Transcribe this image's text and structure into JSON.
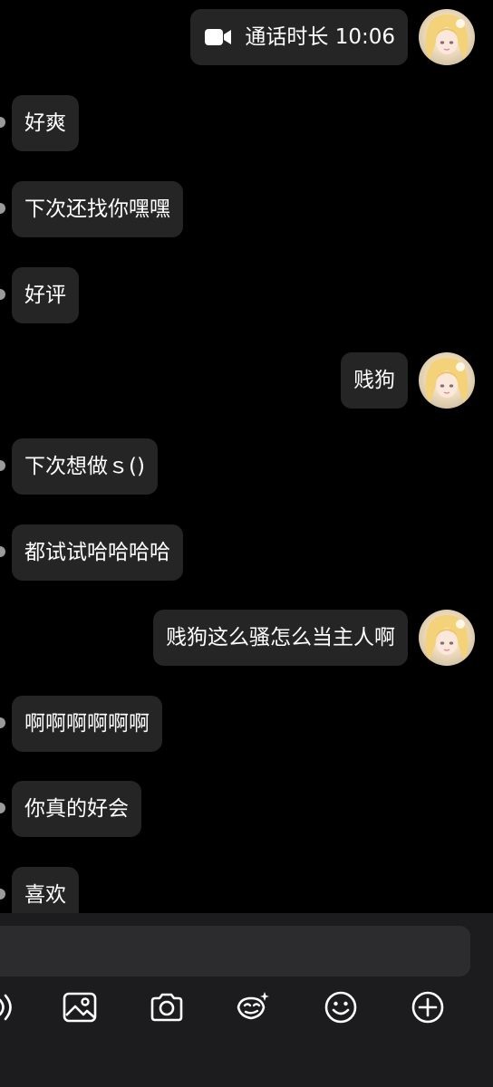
{
  "messages": [
    {
      "side": "right",
      "type": "call",
      "label": "通话时长 10:06",
      "icon": "video-camera-icon"
    },
    {
      "side": "left",
      "text": "好爽"
    },
    {
      "side": "left",
      "text": "下次还找你嘿嘿"
    },
    {
      "side": "left",
      "text": "好评"
    },
    {
      "side": "right",
      "text": "贱狗"
    },
    {
      "side": "left",
      "text": "下次想做ｓ()"
    },
    {
      "side": "left",
      "text": "都试试哈哈哈哈"
    },
    {
      "side": "right",
      "text": "贱狗这么骚怎么当主人啊"
    },
    {
      "side": "left",
      "text": "啊啊啊啊啊啊"
    },
    {
      "side": "left",
      "text": "你真的好会"
    },
    {
      "side": "left",
      "text": "喜欢"
    }
  ],
  "composer": {
    "input_value": "",
    "toolbar": [
      "voice-icon",
      "image-icon",
      "camera-icon",
      "sticker-icon",
      "emoji-icon",
      "plus-icon"
    ]
  },
  "colors": {
    "background": "#000000",
    "bubble": "#252525",
    "composer": "#1c1c1e",
    "input": "#2c2c2e"
  }
}
